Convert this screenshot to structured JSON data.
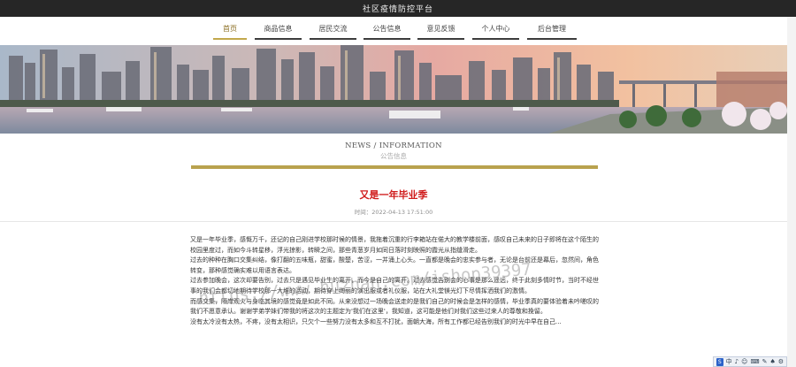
{
  "header": {
    "site_title": "社区疫情防控平台"
  },
  "nav": {
    "items": [
      {
        "label": "首页",
        "active": true
      },
      {
        "label": "商品信息",
        "active": false
      },
      {
        "label": "居民交流",
        "active": false
      },
      {
        "label": "公告信息",
        "active": false
      },
      {
        "label": "意见反馈",
        "active": false
      },
      {
        "label": "个人中心",
        "active": false
      },
      {
        "label": "后台管理",
        "active": false
      }
    ]
  },
  "section": {
    "title_en": "NEWS / INFORMATION",
    "title_cn": "公告信息"
  },
  "article": {
    "title": "又是一年毕业季",
    "time": "时间：2022-04-13 17:51:00",
    "paragraphs": [
      "又是一年毕业季，感慨万千，还记的自己刚进学校那时候的情景，我拖着沉重的行李箱站在偌大的教学楼前面，感叹自己未来的日子即将在这个陌生的校园里度过，而如今斗转星移，浮光掠影，转瞬之间，那些青葱岁月如同日落时刻映照的霞光从指缝滑走。",
      "过去的种种在胸口交集纠结，像打翻的五味瓶，甜蜜，酸楚，苦涩，一并涌上心头。一直都是晚会的忠实参与者，无论是台前还是幕后，忽然间，角色转变，那种感觉确实难以用语言表达。",
      "过去参加晚会，这次却要告别，过去只是遇见毕业生的离开，而今是自己的离开。过去感觉告别会的心事是那么遥远，终于此刻多情时节，当时不经世事的我们会都切地期待学校那一大堆的活动，期待穿上绚丽的演出服或者礼仪服，站在大礼堂镁光灯下尽情挥洒我们的激情。",
      "而感交集，隔岸观火与身临其境的感觉竟是如此不同。从来没想过一场晚会送走的是我们自己的时候会是怎样的感情，毕业季真的要体验着未吟嗟叹的我们不愿意承认。谢谢学弟学妹们带我的将这次的主题定为'我们在这里'，我知道，这可能是他们对我们这些过来人的尊敬和挽留。",
      "没有太冷没有太热，不疼，没有太相识，只欠个一些努力没有太多和互不打扰，面朝大海，所有工作都已经告别我们的时光中早在自己..."
    ]
  },
  "watermark": {
    "text": "https://www.huzhan.com/ishop39397"
  },
  "tray": {
    "logo": "S",
    "items": [
      "中",
      "♪",
      "☺",
      "⌨",
      "✎",
      "♠",
      "⚙"
    ]
  },
  "colors": {
    "topbar": "#262626",
    "accent_gold": "#b9a24e",
    "title_red": "#d01c1c"
  }
}
